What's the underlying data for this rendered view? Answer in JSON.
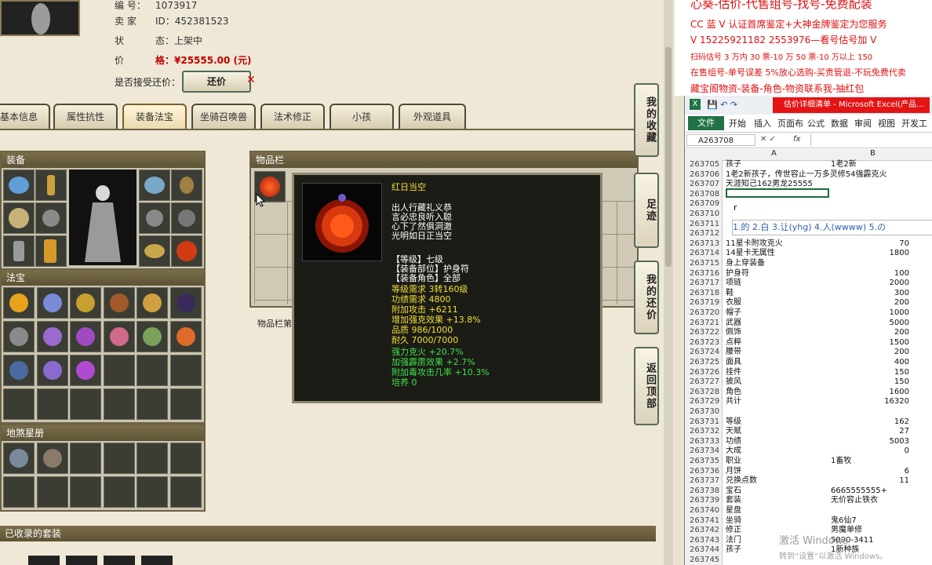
{
  "game": {
    "info": [
      {
        "key": "编  号：",
        "value": "1073917"
      },
      {
        "key": "卖  家",
        "value": "ID：452381523"
      },
      {
        "key": "状",
        "value": "态：上架中"
      },
      {
        "key": "价",
        "value": "格：¥25555.00 (元)"
      }
    ],
    "accept_label": "是否接受还价：",
    "accept_button": "还价",
    "tabs": [
      "基本信息",
      "属性抗性",
      "装备法宝",
      "坐骑召唤兽",
      "法术修正",
      "小孩",
      "外观道具"
    ],
    "panels": {
      "equip": "装备",
      "fabao": "法宝",
      "xingce": "地煞星册",
      "items": "物品栏",
      "items_note": "物品栏第",
      "suits": "已收录的套装"
    },
    "side_buttons": [
      "我的收藏",
      "足迹",
      "我的还价",
      "返回顶部"
    ],
    "tooltip": {
      "title": "红日当空",
      "desc": [
        "出人行藏礼义恭",
        "言必忠良听入聪",
        "心下了然俱洞澈",
        "光明如日正当空"
      ],
      "stats_white": [
        "【等级】七级",
        "【装备部位】护身符",
        "【装备角色】全部"
      ],
      "stats_yellow": [
        "等级需求 3转160级",
        "功绩需求 4800",
        "附加攻击 +6211",
        "增加强克效果 +13.8%",
        "品质 986/1000",
        "耐久 7000/7000"
      ],
      "stats_green": [
        "强力克火 +20.7%",
        "加强霹雳效果 +2.7%",
        "附加毒攻击几率 +10.3%",
        "培养 0"
      ]
    }
  },
  "ad": {
    "lines": [
      "心葵-估价-代售组号-找号-免费配装",
      "CC 蓝 V 认证首席鉴定+大神金牌鉴定为您服务",
      "V 15225921182     2553976—看号估号加 V",
      "扫码估号 3 万内 30 票-10 万 50 票-10 万以上 150",
      "在售组号-单号误差 5%放心选购-买贵管退-不玩免费代卖",
      "藏宝阁物资-装备-角色-物资联系我-抽红包"
    ],
    "colors": {
      "text": "#e01010"
    }
  },
  "excel": {
    "title": "估价详细清单 - Microsoft Excel(产品...",
    "file_tab": "文件",
    "tabs": [
      "开始",
      "插入",
      "页面布",
      "公式",
      "数据",
      "审阅",
      "视图",
      "开发工"
    ],
    "name_box": "A263708",
    "fx": "fx",
    "col_a": "A",
    "col_b": "B",
    "ime": "1.的  2.白  3.让(yhg)  4.人(wwww)  5.の",
    "ime_input": "r",
    "rows": [
      {
        "n": "263705",
        "a": "孩子",
        "b": "1老2新"
      },
      {
        "n": "263706",
        "a": "1老2新孩子，传世容止一万多灵修54强霹克火",
        "b": ""
      },
      {
        "n": "263707",
        "a": "天涯知己162男龙25555",
        "b": ""
      },
      {
        "n": "263708",
        "a": "",
        "b": ""
      },
      {
        "n": "263709",
        "a": "",
        "b": ""
      },
      {
        "n": "263710",
        "a": "",
        "b": ""
      },
      {
        "n": "263711",
        "a": "",
        "b": ""
      },
      {
        "n": "263712",
        "a": "",
        "b": ""
      },
      {
        "n": "263713",
        "a": "11星卡附攻克火",
        "b": "70"
      },
      {
        "n": "263714",
        "a": "14星卡无属性",
        "b": "1800"
      },
      {
        "n": "263715",
        "a": "身上穿装备",
        "b": ""
      },
      {
        "n": "263716",
        "a": "护身符",
        "b": "100"
      },
      {
        "n": "263717",
        "a": "项链",
        "b": "2000"
      },
      {
        "n": "263718",
        "a": "鞋",
        "b": "300"
      },
      {
        "n": "263719",
        "a": "衣服",
        "b": "200"
      },
      {
        "n": "263720",
        "a": "帽子",
        "b": "1000"
      },
      {
        "n": "263721",
        "a": "武器",
        "b": "5000"
      },
      {
        "n": "263722",
        "a": "佩饰",
        "b": "200"
      },
      {
        "n": "263723",
        "a": "点粹",
        "b": "1500"
      },
      {
        "n": "263724",
        "a": "腰带",
        "b": "200"
      },
      {
        "n": "263725",
        "a": "面具",
        "b": "400"
      },
      {
        "n": "263726",
        "a": "挂件",
        "b": "150"
      },
      {
        "n": "263727",
        "a": "披风",
        "b": "150"
      },
      {
        "n": "263728",
        "a": "角色",
        "b": "1600"
      },
      {
        "n": "263729",
        "a": "共计",
        "b": "16320"
      },
      {
        "n": "263730",
        "a": "",
        "b": ""
      },
      {
        "n": "263731",
        "a": "等级",
        "b": "162"
      },
      {
        "n": "263732",
        "a": "天赋",
        "b": "27"
      },
      {
        "n": "263733",
        "a": "功绩",
        "b": "5003"
      },
      {
        "n": "263734",
        "a": "大成",
        "b": "0"
      },
      {
        "n": "263735",
        "a": "职业",
        "b": "1畜牧"
      },
      {
        "n": "263736",
        "a": "月饼",
        "b": "6"
      },
      {
        "n": "263737",
        "a": "兑换点数",
        "b": "11"
      },
      {
        "n": "263738",
        "a": "宝石",
        "b": "6665555555+"
      },
      {
        "n": "263739",
        "a": "套装",
        "b": "无价容止铁衣"
      },
      {
        "n": "263740",
        "a": "星盘",
        "b": ""
      },
      {
        "n": "263741",
        "a": "坐骑",
        "b": "鬼6仙7"
      },
      {
        "n": "263742",
        "a": "修正",
        "b": "男魔单修"
      },
      {
        "n": "263743",
        "a": "法门",
        "b": "5090-3411"
      },
      {
        "n": "263744",
        "a": "孩子",
        "b": "1新种族"
      },
      {
        "n": "263745",
        "a": "",
        "b": ""
      }
    ],
    "watermark": "激活 Windows",
    "watermark_sub": "转到“设置”以激活 Windows。"
  }
}
